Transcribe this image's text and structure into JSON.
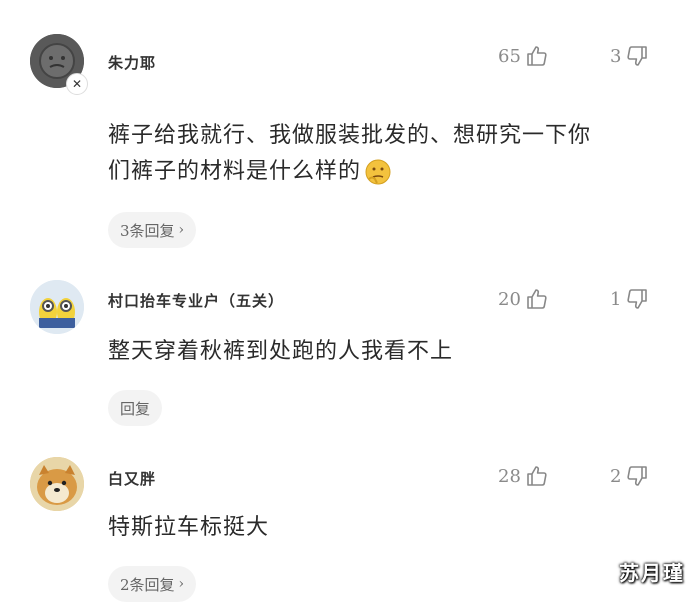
{
  "comments": [
    {
      "name": "朱力耶",
      "likes": "65",
      "dislikes": "3",
      "text_lines": [
        "裤子给我就行、我做服装批发的、想研究一下你",
        "们裤子的材料是什么样的"
      ],
      "reply": "3条回复",
      "avatar": "muted-avatar"
    },
    {
      "name": "村口抬车专业户（五关）",
      "likes": "20",
      "dislikes": "1",
      "text_lines": [
        "整天穿着秋裤到处跑的人我看不上"
      ],
      "reply": "回复",
      "avatar": "minion-avatar"
    },
    {
      "name": "白又胖",
      "likes": "28",
      "dislikes": "2",
      "text_lines": [
        "特斯拉车标挺大"
      ],
      "reply": "2条回复",
      "avatar": "shiba-avatar"
    }
  ],
  "watermark": "苏月瑾"
}
